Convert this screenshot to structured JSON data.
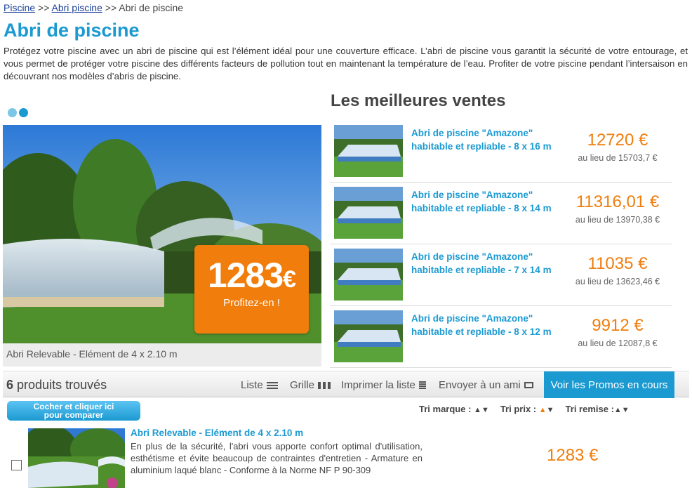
{
  "breadcrumb": {
    "items": [
      "Piscine",
      "Abri piscine",
      "Abri de piscine"
    ],
    "separator": ">>"
  },
  "page": {
    "title": "Abri de piscine",
    "intro": "Protégez votre piscine avec un abri de piscine qui est l’élément idéal pour une couverture efficace. L’abri de piscine vous garantit la sécurité de votre entourage, et vous permet de protéger votre piscine des différents facteurs de pollution tout en maintenant la température de l’eau. Profiter de votre piscine pendant l’intersaison en découvrant nos modèles d’abris de piscine."
  },
  "hero": {
    "price": "1283",
    "currency": "€",
    "cta": "Profitez-en !",
    "caption": "Abri Relevable - Elément de 4 x 2.10 m"
  },
  "bestsellers": {
    "title": "Les meilleures ventes",
    "items": [
      {
        "name": "Abri de piscine \"Amazone\" habitable et repliable - 8 x 16 m",
        "price": "12720 €",
        "old": "au lieu de 15703,7 €"
      },
      {
        "name": "Abri de piscine \"Amazone\" habitable et repliable - 8 x 14 m",
        "price": "11316,01 €",
        "old": "au lieu de 13970,38 €"
      },
      {
        "name": "Abri de piscine \"Amazone\" habitable et repliable - 7 x 14 m",
        "price": "11035 €",
        "old": "au lieu de 13623,46 €"
      },
      {
        "name": "Abri de piscine \"Amazone\" habitable et repliable - 8 x 12 m",
        "price": "9912 €",
        "old": "au lieu de 12087,8 €"
      }
    ]
  },
  "toolbar": {
    "count": "6",
    "found_label": "produits trouvés",
    "list": "Liste",
    "grid": "Grille",
    "print": "Imprimer la liste",
    "send": "Envoyer à un ami",
    "promos": "Voir les Promos en cours"
  },
  "compare": {
    "line1": "Cocher et cliquer ici",
    "line2": "pour comparer"
  },
  "sorts": {
    "brand": "Tri marque :",
    "price": "Tri prix :",
    "discount": "Tri remise :"
  },
  "product": {
    "name": "Abri Relevable - Elément de 4 x 2.10 m",
    "desc": "En plus de la sécurité, l'abri vous apporte confort optimal d'utilisation, esthétisme et évite beaucoup de contraintes d'entretien - Armature en aluminium laqué blanc - Conforme à la Norme NF P 90-309",
    "price": "1283 €"
  },
  "colors": {
    "accent": "#1b9ad2",
    "price": "#f07d0c"
  }
}
